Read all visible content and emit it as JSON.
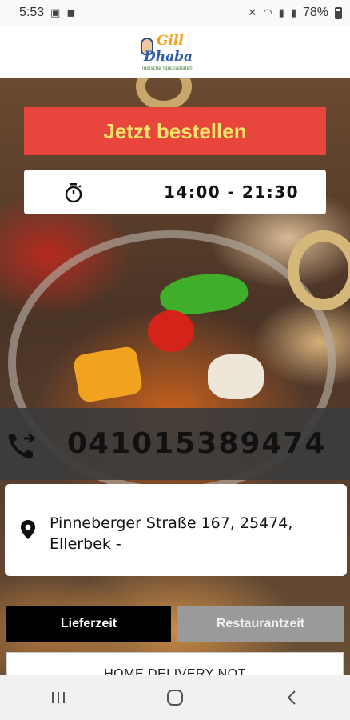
{
  "status_bar": {
    "time": "5:53",
    "battery": "78%"
  },
  "header": {
    "logo_gill": "Gill",
    "logo_dhaba": "Dhaba",
    "logo_tagline": "Indische Spezialitäten"
  },
  "actions": {
    "order_label": "Jetzt bestellen"
  },
  "hours": {
    "value": "14:00 - 21:30"
  },
  "contact": {
    "phone": "041015389474"
  },
  "address": {
    "text": "Pinneberger Straße 167, 25474, Ellerbek -"
  },
  "tabs": [
    {
      "label": "Lieferzeit",
      "active": true
    },
    {
      "label": "Restaurantzeit",
      "active": false
    }
  ],
  "notice": {
    "text": "HOME DELIVERY NOT"
  },
  "colors": {
    "order_button": "#e8453c",
    "order_text": "#f7e36a",
    "active_tab": "#000000",
    "inactive_tab": "#9a9a9a"
  },
  "icons": [
    "image-icon",
    "bag-icon",
    "mute-icon",
    "wifi-icon",
    "signal-icon",
    "battery-icon",
    "timer-icon",
    "phone-forward-icon",
    "location-pin-icon",
    "recents-icon",
    "home-icon",
    "back-icon"
  ]
}
